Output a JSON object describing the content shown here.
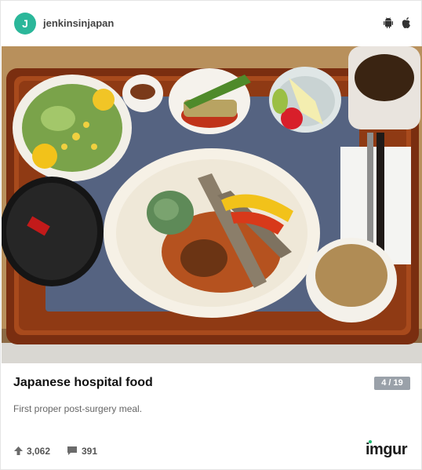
{
  "header": {
    "avatar_initial": "J",
    "username": "jenkinsinjapan",
    "icons": [
      "android-icon",
      "apple-icon"
    ]
  },
  "post": {
    "title": "Japanese hospital food",
    "counter": "4 / 19",
    "description": "First proper post-surgery meal."
  },
  "stats": {
    "upvotes": "3,062",
    "comments": "391"
  },
  "brand": {
    "name": "imgur",
    "dot_color": "#1bb76e"
  },
  "colors": {
    "avatar": "#2bb79a",
    "counter_badge": "#9aa1a9"
  }
}
